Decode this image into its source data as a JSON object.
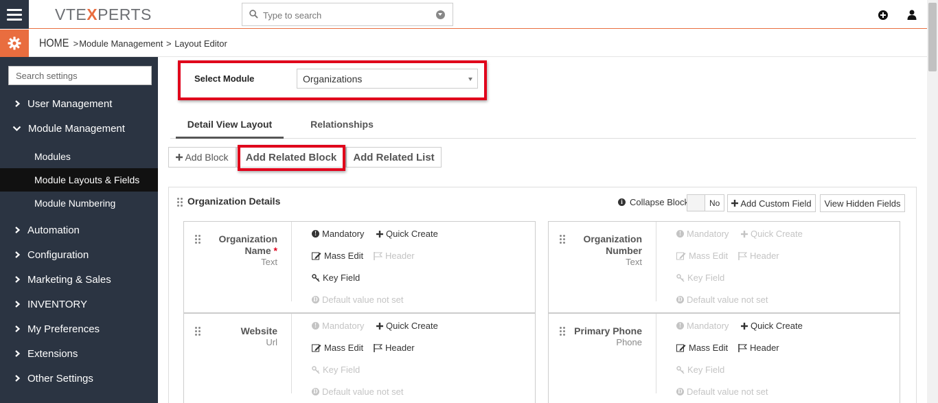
{
  "topbar": {
    "logo_left": "VTE",
    "logo_x": "X",
    "logo_right": "PERTS",
    "search_placeholder": "Type to search"
  },
  "breadcrumb": {
    "home": "HOME",
    "sep1": ">",
    "module_management": "Module Management",
    "sep2": ">",
    "layout_editor": "Layout Editor"
  },
  "sidebar": {
    "search_placeholder": "Search settings",
    "items": [
      {
        "label": "User Management",
        "expanded": false
      },
      {
        "label": "Module Management",
        "expanded": true
      },
      {
        "label": "Automation",
        "expanded": false
      },
      {
        "label": "Configuration",
        "expanded": false
      },
      {
        "label": "Marketing & Sales",
        "expanded": false
      },
      {
        "label": "INVENTORY",
        "expanded": false
      },
      {
        "label": "My Preferences",
        "expanded": false
      },
      {
        "label": "Extensions",
        "expanded": false
      },
      {
        "label": "Other Settings",
        "expanded": false
      }
    ],
    "subitems": [
      {
        "label": "Modules",
        "active": false
      },
      {
        "label": "Module Layouts & Fields",
        "active": true
      },
      {
        "label": "Module Numbering",
        "active": false
      }
    ]
  },
  "main": {
    "select_module_label": "Select Module",
    "select_module_value": "Organizations",
    "tabs": [
      {
        "label": "Detail View Layout",
        "active": true
      },
      {
        "label": "Relationships",
        "active": false
      }
    ],
    "buttons": {
      "add_block": "Add Block",
      "add_related_block": "Add Related Block",
      "add_related_list": "Add Related List"
    },
    "block": {
      "title": "Organization Details",
      "collapse_label": "Collapse Block",
      "collapse_value": "No",
      "add_custom_field": "Add Custom Field",
      "view_hidden_fields": "View Hidden Fields"
    },
    "options": {
      "mandatory": "Mandatory",
      "quick_create": "Quick Create",
      "mass_edit": "Mass Edit",
      "header": "Header",
      "key_field": "Key Field",
      "default_value": "Default value not set"
    },
    "fields": [
      {
        "name_line1": "Organization",
        "name_line2": "Name",
        "required": "*",
        "type": "Text"
      },
      {
        "name_line1": "Organization",
        "name_line2": "Number",
        "required": "",
        "type": "Text"
      },
      {
        "name_line1": "Website",
        "name_line2": "",
        "required": "",
        "type": "Url"
      },
      {
        "name_line1": "Primary Phone",
        "name_line2": "",
        "required": "",
        "type": "Phone"
      }
    ]
  },
  "colors": {
    "accent": "#e96d3f",
    "sidebar_bg": "#2b3442",
    "highlight_red": "#e0001b"
  }
}
